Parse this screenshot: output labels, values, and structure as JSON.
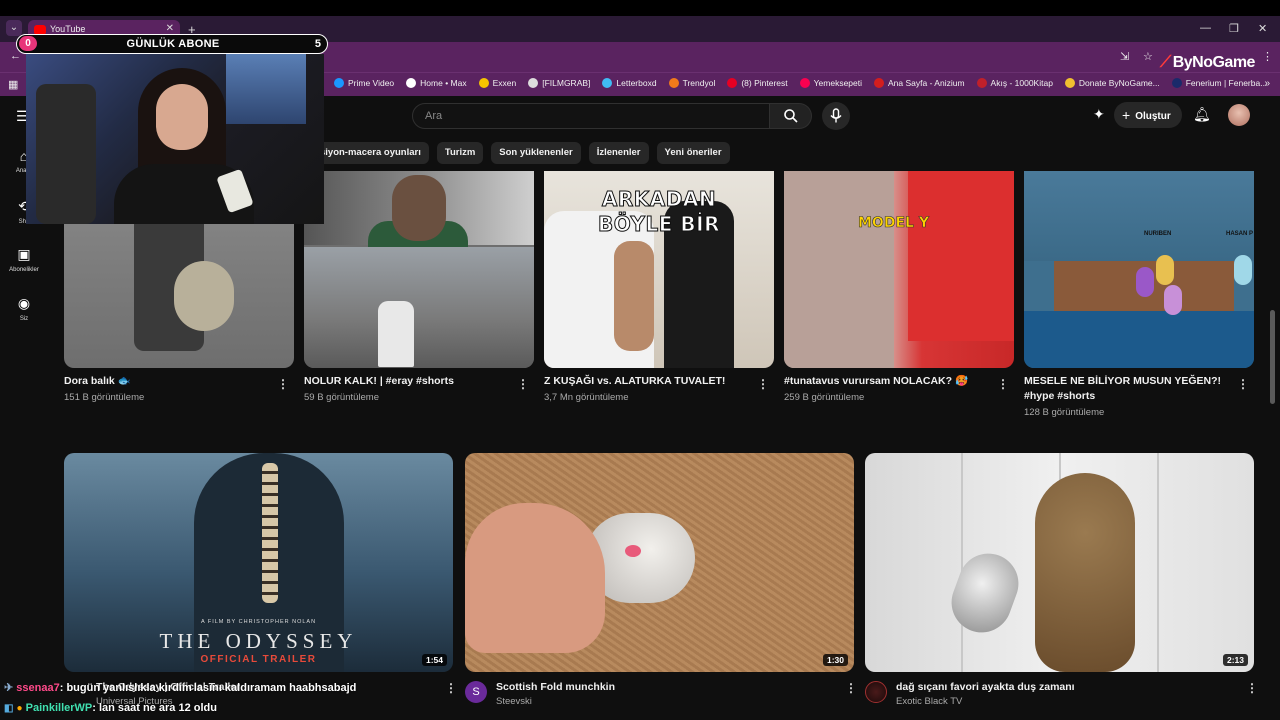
{
  "browser": {
    "tab_title": "YouTube",
    "new_tab_icon": "plus-icon",
    "bookmarks": [
      {
        "label": "Prime Video",
        "color": "#1a98ff"
      },
      {
        "label": "Home • Max",
        "color": "#ffffff"
      },
      {
        "label": "Exxen",
        "color": "#f5c400"
      },
      {
        "label": "[FILMGRAB]",
        "color": "#dddddd"
      },
      {
        "label": "Letterboxd",
        "color": "#40bcf4"
      },
      {
        "label": "Trendyol",
        "color": "#f27a1a"
      },
      {
        "label": "(8) Pinterest",
        "color": "#e60023"
      },
      {
        "label": "Yemeksepeti",
        "color": "#fa0050"
      },
      {
        "label": "Ana Sayfa - Anizium",
        "color": "#d41e1e"
      },
      {
        "label": "Akış - 1000Kitap",
        "color": "#c0202a"
      },
      {
        "label": "Donate ByNoGame...",
        "color": "#f0c030"
      },
      {
        "label": "Fenerium | Fenerba...",
        "color": "#1a2a6a"
      }
    ],
    "brand_watermark": "ByNoGame"
  },
  "youtube": {
    "search_placeholder": "Ara",
    "create_label": "Oluştur",
    "chips": [
      "siyon-macera oyunları",
      "Turizm",
      "Son yüklenenler",
      "İzlenenler",
      "Yeni öneriler"
    ],
    "rail": [
      {
        "label": "Ana S",
        "icon": "home-icon"
      },
      {
        "label": "Sho",
        "icon": "shorts-icon"
      },
      {
        "label": "Abonelikler",
        "icon": "subscriptions-icon"
      },
      {
        "label": "Siz",
        "icon": "you-icon"
      }
    ],
    "shorts": [
      {
        "title": "Dora balık 🐟",
        "views": "151 B görüntüleme"
      },
      {
        "title": "NOLUR KALK! | #eray #shorts",
        "views": "59 B görüntüleme"
      },
      {
        "title": "Z KUŞAĞI vs. ALATURKA TUVALET!",
        "views": "3,7 Mn görüntüleme",
        "overlay": "ARKADAN BÖYLE BİR"
      },
      {
        "title": "#tunatavus vurursam NOLACAK? 🥵",
        "views": "259 B görüntüleme",
        "overlay": "MODEL Y"
      },
      {
        "title": "MESELE NE BİLİYOR MUSUN YEĞEN?! #hype #shorts",
        "views": "128 B görüntüleme",
        "tags": [
          "NURIBEN",
          "HASAN P"
        ]
      }
    ],
    "videos": [
      {
        "title": "The Odyssey | Official Trailer",
        "channel": "Universal Pictures",
        "duration": "1:54",
        "film_by": "A FILM BY CHRISTOPHER NOLAN",
        "poster_title": "THE ODYSSEY",
        "poster_sub": "OFFICIAL TRAILER"
      },
      {
        "title": "Scottish Fold munchkin",
        "channel": "Steevski",
        "duration": "1:30",
        "avatar_letter": "S"
      },
      {
        "title": "dağ sıçanı favori ayakta duş zamanı",
        "channel": "Exotic Black TV",
        "duration": "2:13"
      }
    ]
  },
  "stream_overlay": {
    "sub_counter_left": "0",
    "sub_counter_title": "GÜNLÜK ABONE",
    "sub_counter_right": "5",
    "chat": [
      {
        "user": "ssenaa7",
        "message": ": bugün yanlıslıkla kırdım",
        "suffix": "lasını kaldıramam haabhsabajd"
      },
      {
        "user": "PainkillerWP",
        "message": ": lan saat ne ara 12 oldu"
      }
    ]
  }
}
